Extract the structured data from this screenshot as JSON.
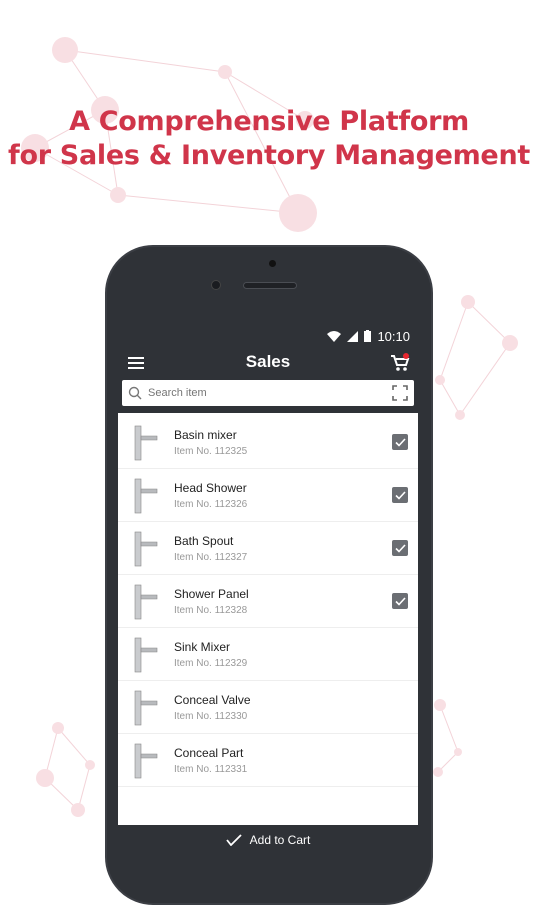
{
  "headline": {
    "line1": "A Comprehensive Platform",
    "line2": "for Sales & Inventory Management"
  },
  "colors": {
    "accent": "#d0354a",
    "appbar": "#2f3237",
    "checkbox": "#6b6e73"
  },
  "status": {
    "time": "10:10",
    "icons": [
      "wifi-icon",
      "signal-icon",
      "battery-icon"
    ]
  },
  "toolbar": {
    "title": "Sales",
    "menu_icon": "hamburger-icon",
    "cart_icon": "cart-icon",
    "cart_badge": true
  },
  "search": {
    "placeholder": "Search item",
    "scan_icon": "scan-frame-icon"
  },
  "items": [
    {
      "name": "Basin mixer",
      "number": "Item No. 112325",
      "checked": true
    },
    {
      "name": "Head Shower",
      "number": "Item No. 112326",
      "checked": true
    },
    {
      "name": "Bath Spout",
      "number": "Item No. 112327",
      "checked": true
    },
    {
      "name": "Shower Panel",
      "number": "Item No. 112328",
      "checked": true
    },
    {
      "name": "Sink Mixer",
      "number": "Item No. 112329",
      "checked": false
    },
    {
      "name": "Conceal Valve",
      "number": "Item No. 112330",
      "checked": false
    },
    {
      "name": "Conceal Part",
      "number": "Item No. 112331",
      "checked": false
    }
  ],
  "bottom": {
    "label": "Add to Cart",
    "icon": "checkmark-icon"
  }
}
